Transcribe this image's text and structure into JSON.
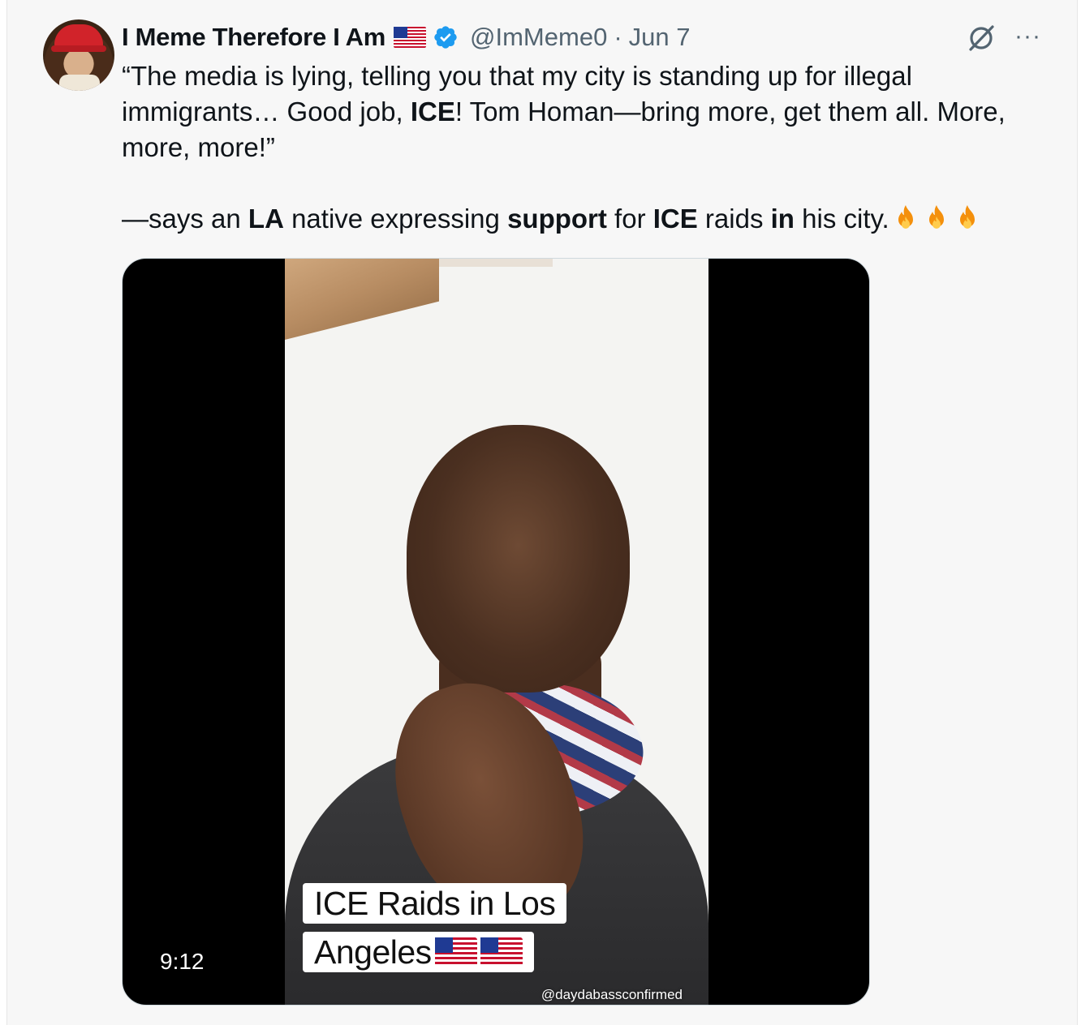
{
  "author": {
    "name": "I Meme Therefore I Am",
    "flag_icon": "us-flag-icon",
    "verified_icon": "verified-badge-icon",
    "handle": "@ImMeme0",
    "separator": "·",
    "date": "Jun 7"
  },
  "actions": {
    "grok_icon": "grok-icon",
    "more_label": "···"
  },
  "tweet": {
    "quote_line": "“The media is lying, telling you that my city is standing up for illegal immigrants… Good job, ",
    "ice_1": "ICE",
    "quote_mid": "! Tom Homan—bring more, get them all. More, more, more!”",
    "says_prefix": "—says an ",
    "la": "LA",
    "native": " native expressing ",
    "support": "support",
    "for_word": " for ",
    "ice_2": "ICE",
    "raids": " raids ",
    "in_word": "in",
    "his_city": " his city.",
    "emoji": "fire-emoji x3"
  },
  "media": {
    "caption_line1": "ICE Raids in Los",
    "caption_line2": "Angeles",
    "watermark": "@daydabassconfirmed",
    "duration": "9:12"
  },
  "colors": {
    "text": "#0f1419",
    "muted": "#536471",
    "verified": "#1d9bf0",
    "background": "#f7f7f7"
  }
}
